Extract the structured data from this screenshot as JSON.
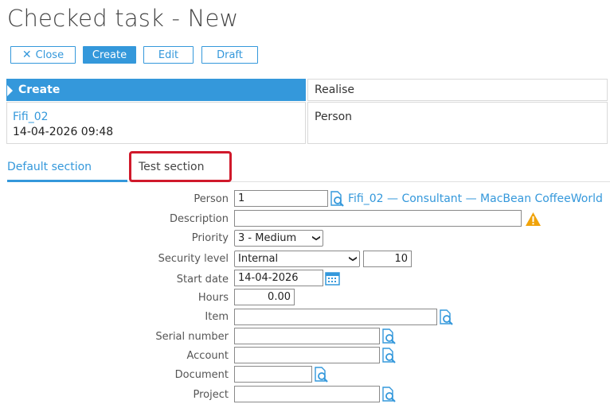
{
  "page": {
    "title": "Checked task - New"
  },
  "toolbar": {
    "close": "Close",
    "create": "Create",
    "edit": "Edit",
    "draft": "Draft"
  },
  "workflow": {
    "steps": [
      "Create",
      "Realise"
    ],
    "create_user": "Fifi_02",
    "create_datetime": "14-04-2026 09:48",
    "realise_field": "Person"
  },
  "tabs": [
    "Default section",
    "Test section"
  ],
  "form": {
    "person": {
      "label": "Person",
      "value": "1",
      "lookup_text": "Fifi_02 — Consultant — MacBean CoffeeWorld"
    },
    "description": {
      "label": "Description",
      "value": ""
    },
    "priority": {
      "label": "Priority",
      "value": "3 - Medium"
    },
    "security_level": {
      "label": "Security level",
      "value": "Internal",
      "number": "10"
    },
    "start_date": {
      "label": "Start date",
      "value": "14-04-2026"
    },
    "hours": {
      "label": "Hours",
      "value": "0.00"
    },
    "item": {
      "label": "Item",
      "value": ""
    },
    "serial_number": {
      "label": "Serial number",
      "value": ""
    },
    "account": {
      "label": "Account",
      "value": ""
    },
    "document": {
      "label": "Document",
      "value": ""
    },
    "project": {
      "label": "Project",
      "value": ""
    }
  },
  "colors": {
    "accent": "#3498db",
    "highlight": "#d0192b",
    "warning": "#f0a30a"
  }
}
